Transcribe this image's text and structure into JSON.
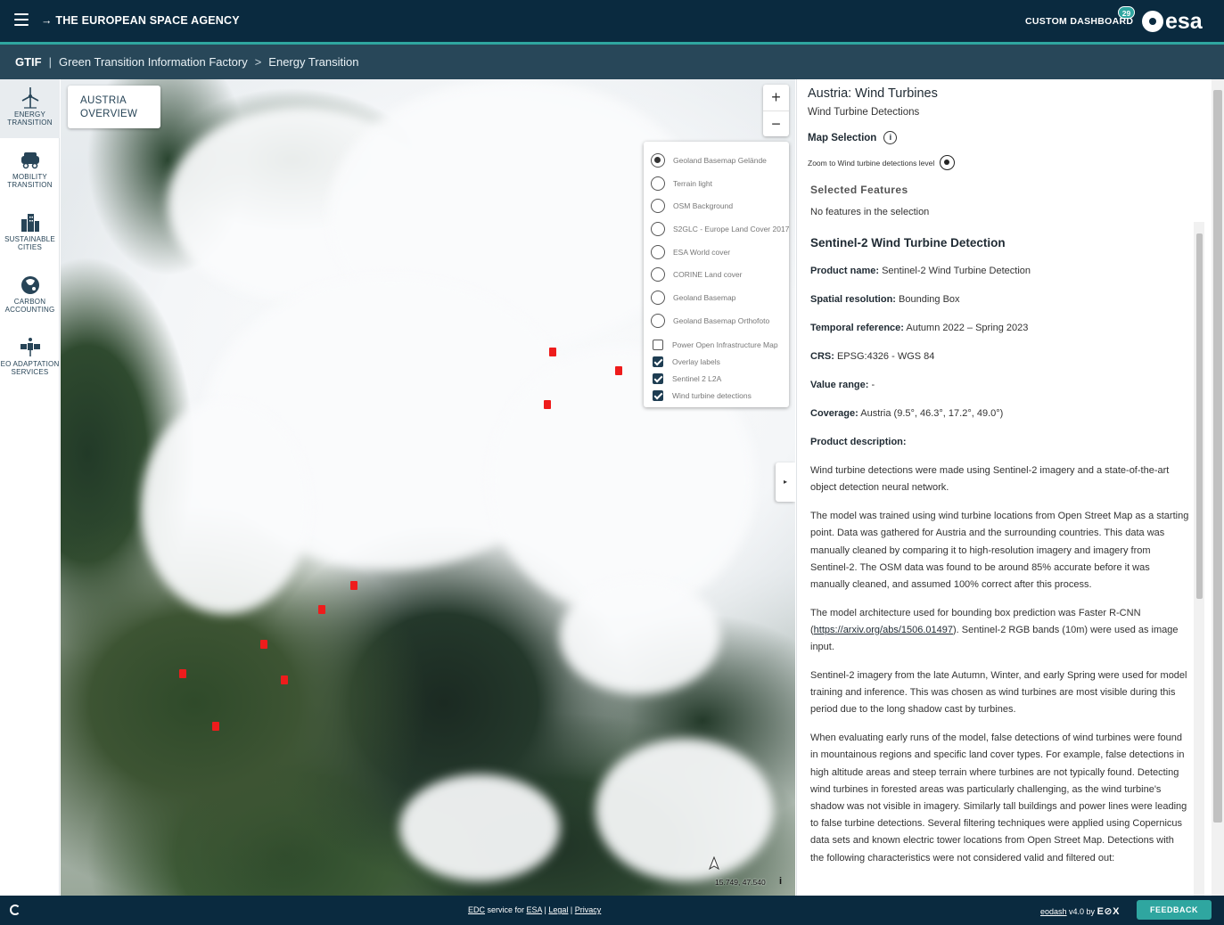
{
  "header": {
    "agency": "→ THE EUROPEAN SPACE AGENCY",
    "custom_dashboard": "CUSTOM DASHBOARD",
    "badge_count": "29",
    "logo_text": "esa"
  },
  "breadcrumb": {
    "root": "GTIF",
    "separator": "|",
    "section": "Green Transition Information Factory",
    "arrow": ">",
    "current": "Energy Transition"
  },
  "nav": {
    "items": [
      {
        "label": "ENERGY TRANSITION",
        "icon": "wind-turbine-icon",
        "active": true
      },
      {
        "label": "MOBILITY TRANSITION",
        "icon": "mobility-icon",
        "active": false
      },
      {
        "label": "SUSTAINABLE CITIES",
        "icon": "city-icon",
        "active": false
      },
      {
        "label": "CARBON ACCOUNTING",
        "icon": "carbon-icon",
        "active": false
      },
      {
        "label": "EO ADAPTATION SERVICES",
        "icon": "satellite-icon",
        "active": false
      }
    ]
  },
  "map": {
    "overview_button": "AUSTRIA OVERVIEW",
    "zoom_in": "+",
    "zoom_out": "−",
    "coordinates": "15.749, 47.540",
    "info": "i",
    "panel_toggle": "▸",
    "base_layers": [
      {
        "label": "Geoland Basemap Gelände",
        "selected": true
      },
      {
        "label": "Terrain light",
        "selected": false
      },
      {
        "label": "OSM Background",
        "selected": false
      },
      {
        "label": "S2GLC - Europe Land Cover 2017",
        "selected": false
      },
      {
        "label": "ESA World cover",
        "selected": false
      },
      {
        "label": "CORINE Land cover",
        "selected": false
      },
      {
        "label": "Geoland Basemap",
        "selected": false
      },
      {
        "label": "Geoland Basemap Orthofoto",
        "selected": false
      }
    ],
    "overlays": [
      {
        "label": "Power Open Infrastructure Map",
        "checked": false
      },
      {
        "label": "Overlay labels",
        "checked": true
      },
      {
        "label": "Sentinel 2 L2A",
        "checked": true
      },
      {
        "label": "Wind turbine detections",
        "checked": true
      }
    ],
    "marker_color": "#ee1c1c"
  },
  "panel": {
    "title": "Austria: Wind Turbines",
    "subtitle": "Wind Turbine Detections",
    "map_selection": "Map Selection",
    "info_icon": "i",
    "zoom_to": "Zoom to Wind turbine detections level",
    "selected_heading": "Selected Features",
    "selected_none": "No features in the selection",
    "product_heading": "Sentinel-2 Wind Turbine Detection",
    "fields": [
      {
        "label": "Product name:",
        "value": " Sentinel-2 Wind Turbine Detection"
      },
      {
        "label": "Spatial resolution:",
        "value": " Bounding Box"
      },
      {
        "label": "Temporal reference:",
        "value": " Autumn 2022 – Spring 2023"
      },
      {
        "label": "CRS:",
        "value": " EPSG:4326 - WGS 84"
      },
      {
        "label": "Value range:",
        "value": " -"
      },
      {
        "label": "Coverage:",
        "value": " Austria (9.5°, 46.3°, 17.2°, 49.0°)"
      },
      {
        "label": "Product description:",
        "value": ""
      }
    ],
    "paragraphs": {
      "p1": "Wind turbine detections were made using Sentinel-2 imagery and a state-of-the-art object detection neural network.",
      "p2": "The model was trained using wind turbine locations from Open Street Map as a starting point. Data was gathered for Austria and the surrounding countries. This data was manually cleaned by comparing it to high-resolution imagery and imagery from Sentinel-2. The OSM data was found to be around 85% accurate before it was manually cleaned, and assumed 100% correct after this process.",
      "p3_before": "The model architecture used for bounding box prediction was Faster R-CNN (",
      "p3_link": "https://arxiv.org/abs/1506.01497",
      "p3_after": "). Sentinel-2 RGB bands (10m) were used as image input.",
      "p4": "Sentinel-2 imagery from the late Autumn, Winter, and early Spring were used for model training and inference. This was chosen as wind turbines are most visible during this period due to the long shadow cast by turbines.",
      "p5": "When evaluating early runs of the model, false detections of wind turbines were found in mountainous regions and specific land cover types. For example, false detections in high altitude areas and steep terrain where turbines are not typically found. Detecting wind turbines in forested areas was particularly challenging, as the wind turbine's shadow was not visible in imagery. Similarly tall buildings and power lines were leading to false turbine detections. Several filtering techniques were applied using Copernicus data sets and known electric tower locations from Open Street Map. Detections with the following characteristics were not considered valid and filtered out:"
    }
  },
  "footer": {
    "edc": "EDC",
    "service_for": " service for ",
    "esa": "ESA",
    "pipe1": " | ",
    "legal": "Legal",
    "pipe2": " | ",
    "privacy": "Privacy",
    "eodash": "eodash",
    "version": " v4.0 by ",
    "eox": "E⊘X",
    "feedback": "FEEDBACK"
  }
}
